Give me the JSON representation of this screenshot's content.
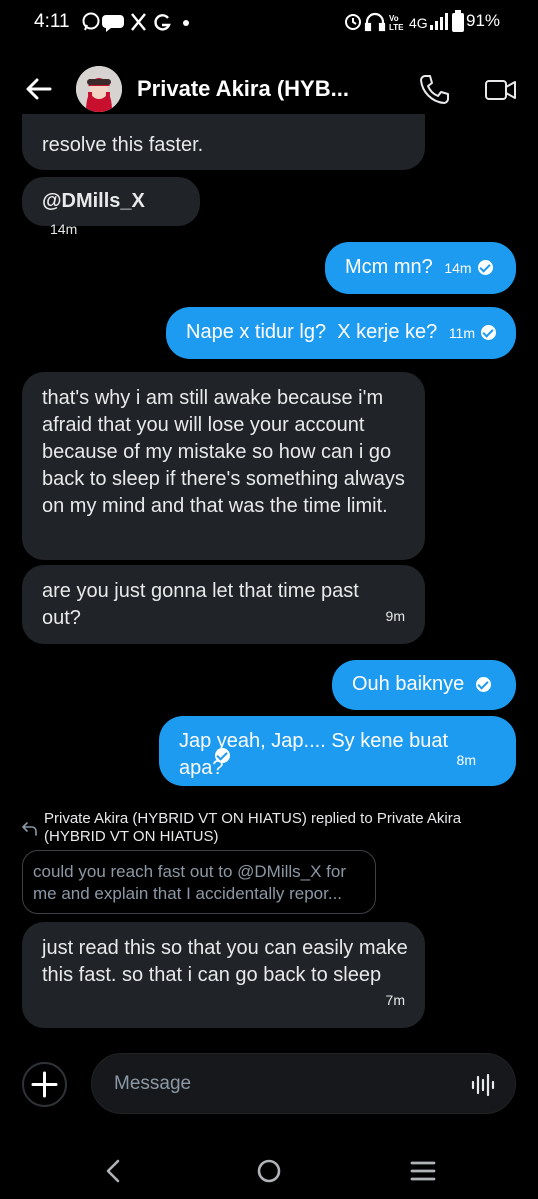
{
  "status_bar": {
    "time": "4:11",
    "icons": [
      "whatsapp-icon",
      "chat-icon",
      "x-icon",
      "google-icon",
      "dot-icon"
    ],
    "right_icons": [
      "alarm-icon",
      "headphones-icon",
      "volte-icon",
      "4g-icon",
      "signal-icon"
    ],
    "volte_label": "VoLTE",
    "network": "4G",
    "battery": "91%"
  },
  "header": {
    "title": "Private Akira (HYB..."
  },
  "messages": [
    {
      "side": "received",
      "text": "resolve this faster.",
      "time": ""
    },
    {
      "side": "received",
      "text": "@DMills_X",
      "time": "14m"
    },
    {
      "side": "sent",
      "text": "Mcm mn?",
      "time": "14m"
    },
    {
      "side": "sent",
      "text": "Nape x tidur lg?  X kerje ke?",
      "time": "11m"
    },
    {
      "side": "received",
      "text": "that's why i am still awake because i'm afraid that you will lose your account because of my mistake so how can i go back to sleep if there's something always on my mind and that was the time limit.",
      "time": ""
    },
    {
      "side": "received",
      "text": "are you just gonna let that time past out?",
      "time": "9m"
    },
    {
      "side": "sent",
      "text": "Ouh baiknye",
      "time": ""
    },
    {
      "side": "sent",
      "text": "Jap yeah, Jap.... Sy kene buat apa?",
      "time": "8m"
    }
  ],
  "reply": {
    "header": "Private Akira (HYBRID VT ON HIATUS) replied to Private Akira (HYBRID VT ON HIATUS)",
    "quoted": "could you reach fast out to @DMills_X for me and explain that I accidentally repor...",
    "text": "just read this so that you can easily make this fast. so that i can go back to sleep",
    "time": "7m"
  },
  "composer": {
    "placeholder": "Message"
  },
  "nav": [
    "back-nav-icon",
    "home-nav-icon",
    "recents-nav-icon"
  ]
}
